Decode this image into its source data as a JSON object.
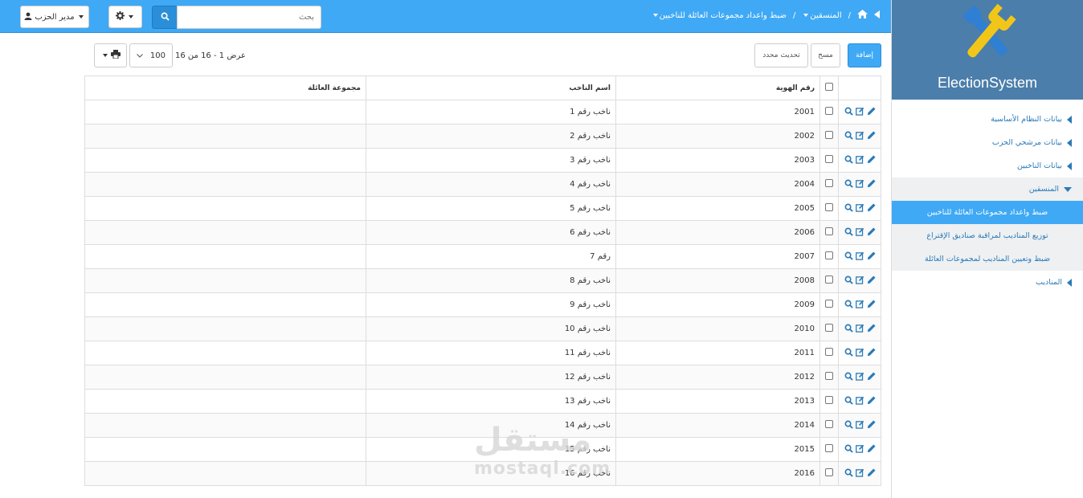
{
  "app": {
    "title": "ElectionSystem"
  },
  "header": {
    "user_label": "مدير الحزب",
    "search_placeholder": "بحث",
    "breadcrumb": {
      "section": "المنسقين",
      "page": "ضبط واعداد مجموعات العائلة للناخبين"
    }
  },
  "sidebar": {
    "items": [
      {
        "label": "بيانات النظام الأساسية"
      },
      {
        "label": "بيانات مرشحي الحزب"
      },
      {
        "label": "بيانات الناخبين"
      },
      {
        "label": "المنسقين"
      },
      {
        "label": "ضبط واعداد مجموعات العائلة للناخبين"
      },
      {
        "label": "توزيع المناديب لمراقبة صناديق الإقتراع"
      },
      {
        "label": "ضبط وتعيين المناديب لمجموعات العائلة"
      },
      {
        "label": "المناديب"
      }
    ]
  },
  "toolbar": {
    "add_label": "إضافة",
    "clear_label": "مسح",
    "update_label": "تحديث محدد",
    "pager_text": "عرض 1 - 16 من 16",
    "page_size": "100"
  },
  "table": {
    "headers": {
      "id": "رقم الهوية",
      "name": "اسم الناخب",
      "family": "مجموعة العائلة"
    },
    "rows": [
      {
        "id": "2001",
        "name": "ناخب رقم 1",
        "family": ""
      },
      {
        "id": "2002",
        "name": "ناخب رقم 2",
        "family": ""
      },
      {
        "id": "2003",
        "name": "ناخب رقم 3",
        "family": ""
      },
      {
        "id": "2004",
        "name": "ناخب رقم 4",
        "family": ""
      },
      {
        "id": "2005",
        "name": "ناخب رقم 5",
        "family": ""
      },
      {
        "id": "2006",
        "name": "ناخب رقم 6",
        "family": ""
      },
      {
        "id": "2007",
        "name": "رقم 7",
        "family": ""
      },
      {
        "id": "2008",
        "name": "ناخب رقم 8",
        "family": ""
      },
      {
        "id": "2009",
        "name": "ناخب رقم 9",
        "family": ""
      },
      {
        "id": "2010",
        "name": "ناخب رقم 10",
        "family": ""
      },
      {
        "id": "2011",
        "name": "ناخب رقم 11",
        "family": ""
      },
      {
        "id": "2012",
        "name": "ناخب رقم 12",
        "family": ""
      },
      {
        "id": "2013",
        "name": "ناخب رقم 13",
        "family": ""
      },
      {
        "id": "2014",
        "name": "ناخب رقم 14",
        "family": ""
      },
      {
        "id": "2015",
        "name": "ناخب رقم 15",
        "family": ""
      },
      {
        "id": "2016",
        "name": "ناخب رقم 16",
        "family": ""
      }
    ]
  },
  "watermark": {
    "arabic": "مستقل",
    "latin": "mostaql.com"
  },
  "colors": {
    "primary": "#3fa9f5",
    "sidebar_header": "#4b7eaa",
    "link": "#2a7ab8",
    "icon_yellow": "#f2c618",
    "icon_blue": "#2f7fd4"
  }
}
